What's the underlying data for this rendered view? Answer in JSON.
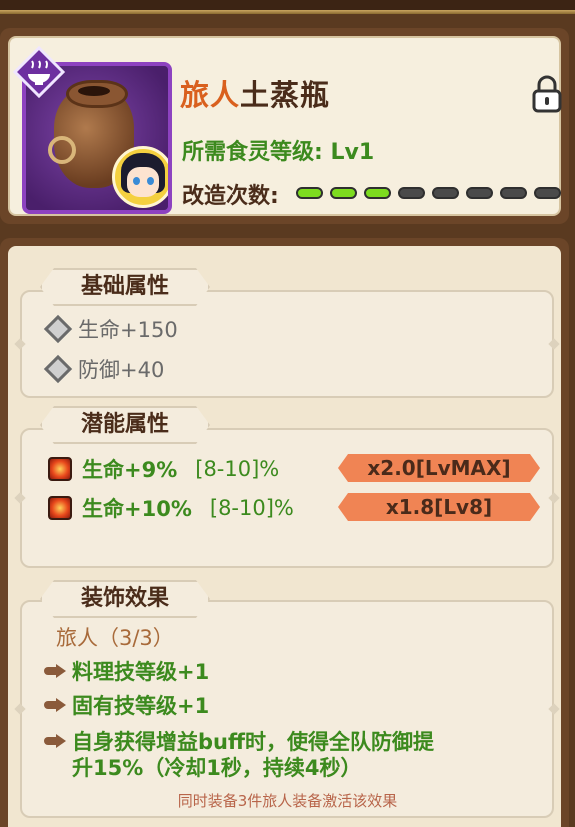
{
  "header": {
    "title_prefix": "旅人",
    "title_name": "土蒸瓶",
    "requirement": "所需食灵等级: Lv1",
    "mod_label": "改造次数:",
    "mod_pips_on": 3,
    "mod_pips_total": 8,
    "icons": {
      "category": "steam-bowl-icon",
      "lock": "lock-icon"
    }
  },
  "basic": {
    "tab": "基础属性",
    "stats": [
      "生命+150",
      "防御+40"
    ]
  },
  "potential": {
    "tab": "潜能属性",
    "stats": [
      {
        "stat": "生命+9%",
        "range": "[8-10]%",
        "badge": "x2.0[LvMAX]"
      },
      {
        "stat": "生命+10%",
        "range": "[8-10]%",
        "badge": "x1.8[Lv8]"
      }
    ]
  },
  "set": {
    "tab": "装饰效果",
    "name": "旅人（3/3）",
    "effects": [
      "料理技等级+1",
      "固有技等级+1",
      "自身获得增益buff时，使得全队防御提",
      "升15%（冷却1秒，持续4秒）"
    ],
    "note": "同时装备3件旅人装备激活该效果"
  },
  "colors": {
    "title_prefix": "#d9601e",
    "green_text": "#3c8a1e",
    "pip_on": "#7ddc1f",
    "ribbon": "#f08454",
    "item_frame": "#8d42c0"
  }
}
